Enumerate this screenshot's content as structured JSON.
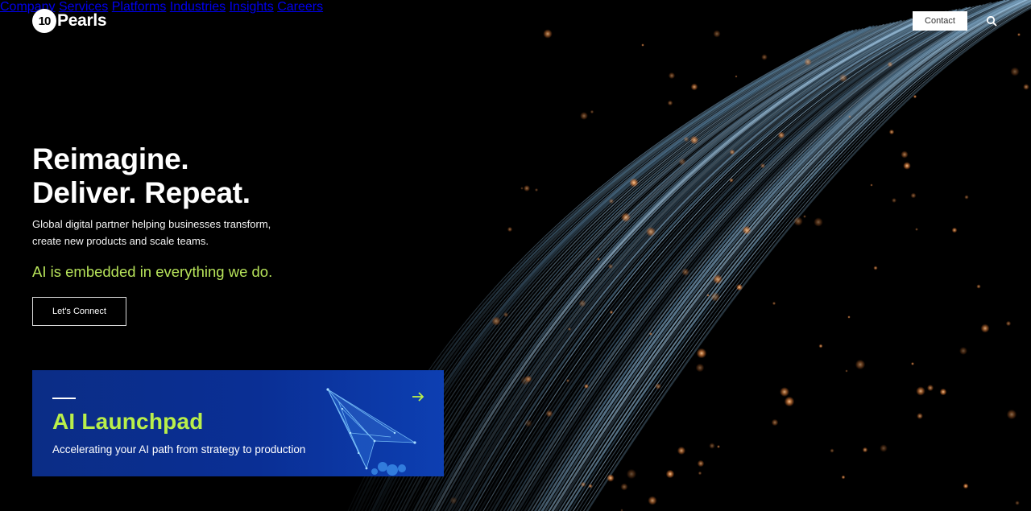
{
  "brand": {
    "logo_mark": "10",
    "logo_text": "Pearls"
  },
  "nav": {
    "items": [
      "Company",
      "Services",
      "Platforms",
      "Industries",
      "Insights",
      "Careers"
    ],
    "contact_label": "Contact",
    "search_icon": "search-icon"
  },
  "hero": {
    "headline_line1": "Reimagine.",
    "headline_line2": "Deliver. Repeat.",
    "subtext": "Global digital partner helping businesses transform, create new products and scale teams.",
    "ai_line": "AI is embedded in everything we do.",
    "cta_label": "Let's Connect"
  },
  "promo_card": {
    "title": "AI Launchpad",
    "subtitle": "Accelerating your AI path from strategy to production",
    "arrow_icon": "arrow-right-icon"
  },
  "colors": {
    "accent_green": "#b7e35a",
    "card_blue": "#0a2f95",
    "background": "#000000"
  }
}
